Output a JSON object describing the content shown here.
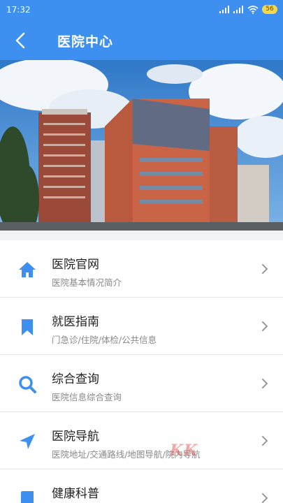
{
  "status_bar": {
    "time": "17:32",
    "battery": "56",
    "icons": [
      "signal-icon",
      "signal-icon",
      "wifi-icon",
      "battery-icon"
    ]
  },
  "nav": {
    "title": "医院中心",
    "back_icon": "chevron-left-icon"
  },
  "menu": {
    "items": [
      {
        "title": "医院官网",
        "subtitle": "医院基本情况简介",
        "icon": "home-icon"
      },
      {
        "title": "就医指南",
        "subtitle": "门急诊/住院/体检/公共信息",
        "icon": "bookmark-icon"
      },
      {
        "title": "综合查询",
        "subtitle": "医院信息综合查询",
        "icon": "search-icon"
      },
      {
        "title": "医院导航",
        "subtitle": "医院地址/交通路线/地图导航/院内导航",
        "icon": "navigation-arrow-icon"
      },
      {
        "title": "健康科普",
        "subtitle": "",
        "icon": "book-icon"
      }
    ]
  },
  "colors": {
    "primary": "#3d8ff0",
    "icon": "#3d8ff0"
  }
}
